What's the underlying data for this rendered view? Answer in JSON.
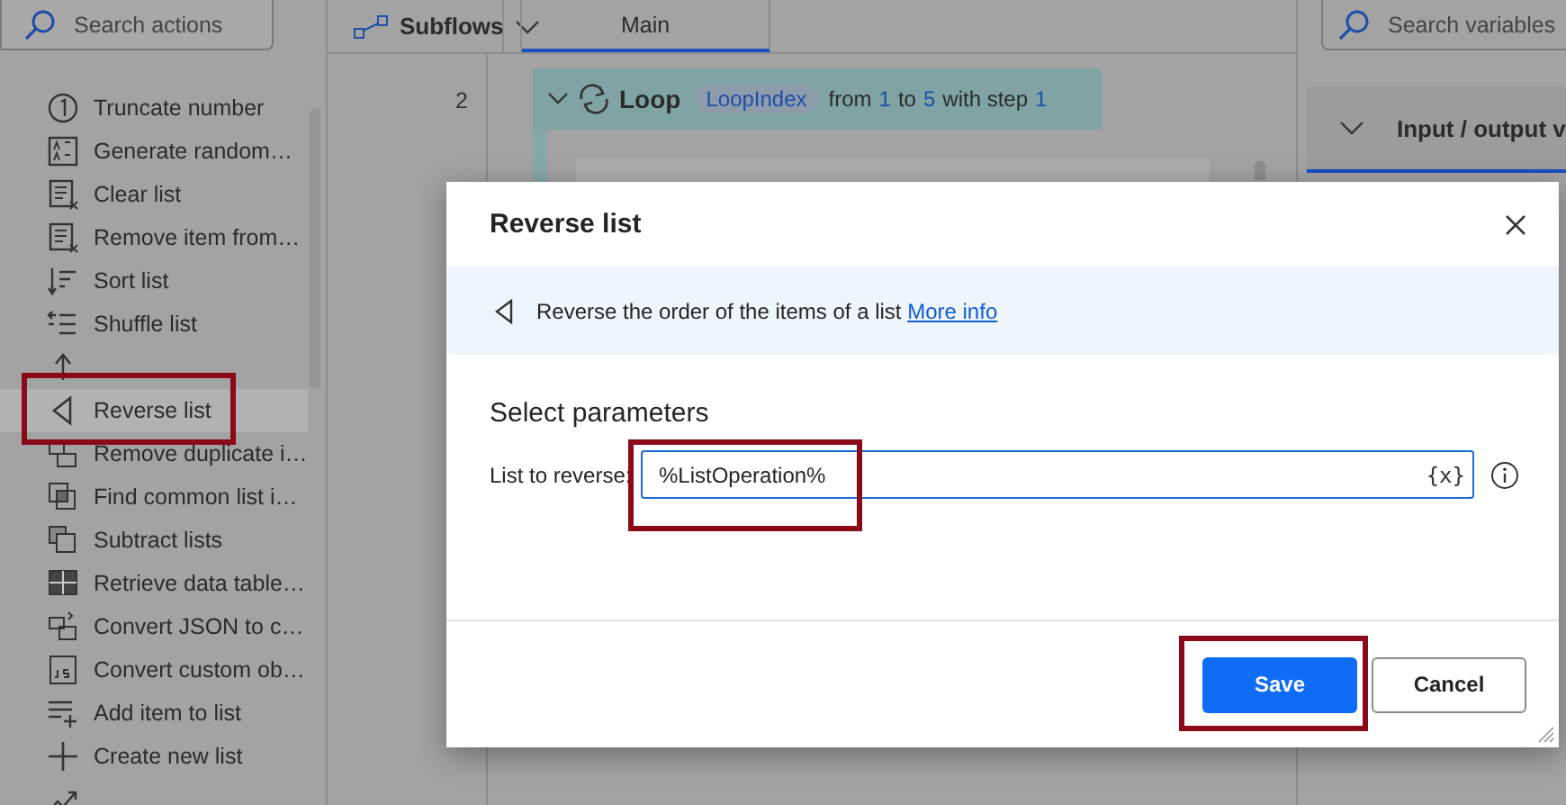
{
  "actions_panel": {
    "search": {
      "placeholder": "Search actions"
    },
    "items": [
      {
        "label": "Truncate number",
        "selected": false
      },
      {
        "label": "Generate random…",
        "selected": false
      },
      {
        "label": "Clear list",
        "selected": false
      },
      {
        "label": "Remove item from…",
        "selected": false
      },
      {
        "label": "Sort list",
        "selected": false
      },
      {
        "label": "Shuffle list",
        "selected": false
      },
      {
        "selected": false
      },
      {
        "label": "Reverse list",
        "selected": true
      },
      {
        "label": "Remove duplicate i…",
        "selected": false
      },
      {
        "label": "Find common list i…",
        "selected": false
      },
      {
        "label": "Subtract lists",
        "selected": false
      },
      {
        "label": "Retrieve data table…",
        "selected": false
      },
      {
        "label": "Convert JSON to c…",
        "selected": false
      },
      {
        "label": "Convert custom ob…",
        "selected": false
      },
      {
        "label": "Add item to list",
        "selected": false
      },
      {
        "label": "Create new list",
        "selected": false
      },
      {
        "selected": false
      }
    ]
  },
  "editor": {
    "subflows_button": "Subflows",
    "tabs": [
      {
        "label": "Main",
        "selected": true
      }
    ],
    "line_number": "2",
    "loop": {
      "keyword": "Loop",
      "variable": "LoopIndex",
      "parts": [
        {
          "text": "from",
          "kind": "plain"
        },
        {
          "text": "1",
          "kind": "value"
        },
        {
          "text": "to",
          "kind": "plain"
        },
        {
          "text": "5",
          "kind": "value"
        },
        {
          "text": "with step",
          "kind": "plain"
        },
        {
          "text": "1",
          "kind": "value"
        }
      ]
    },
    "steps": [
      {
        "kind": "card"
      }
    ]
  },
  "variables_panel": {
    "search": {
      "placeholder": "Search variables"
    },
    "section": "Input / output v"
  },
  "dialog": {
    "title": "Reverse list",
    "description": "Reverse the order of the items of a list",
    "link": "More info",
    "section": "Select parameters",
    "field": {
      "label": "List to reverse:",
      "value": "%ListOperation%",
      "variable_button": "{x}"
    },
    "buttons": [
      {
        "label": "Save",
        "kind": "primary"
      },
      {
        "label": "Cancel",
        "kind": "secondary"
      }
    ]
  }
}
